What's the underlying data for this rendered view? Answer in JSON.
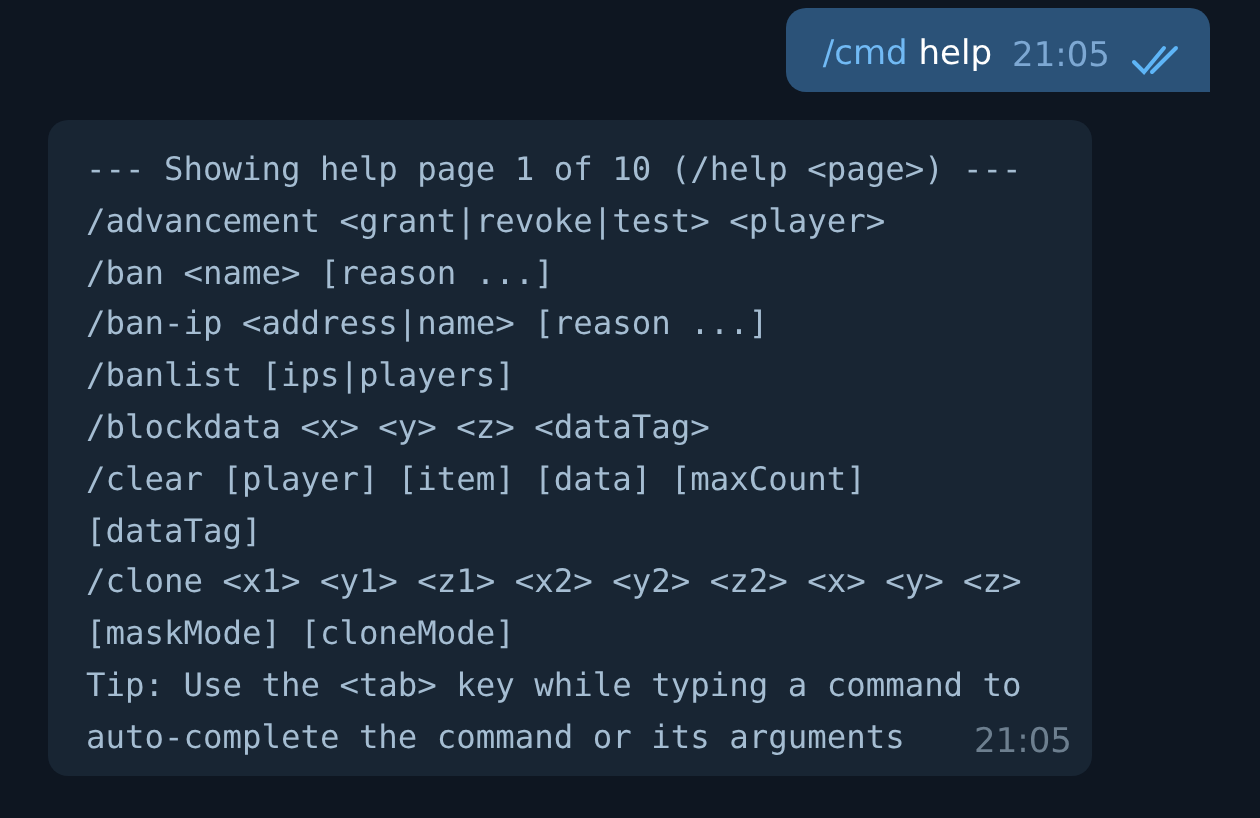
{
  "outgoing": {
    "command": "/cmd",
    "text": "help",
    "time": "21:05",
    "read": true
  },
  "incoming": {
    "lines": [
      "--- Showing help page 1 of 10 (/help <page>) ---",
      "/advancement <grant|revoke|test> <player>",
      "/ban <name> [reason ...]",
      "/ban-ip <address|name> [reason ...]",
      "/banlist [ips|players]",
      "/blockdata <x> <y> <z> <dataTag>",
      "/clear [player] [item] [data] [maxCount]",
      "[dataTag]",
      "/clone <x1> <y1> <z1> <x2> <y2> <z2> <x> <y> <z>",
      "[maskMode] [cloneMode]",
      "Tip: Use the <tab> key while typing a command to",
      "auto-complete the command or its arguments"
    ],
    "time": "21:05"
  }
}
